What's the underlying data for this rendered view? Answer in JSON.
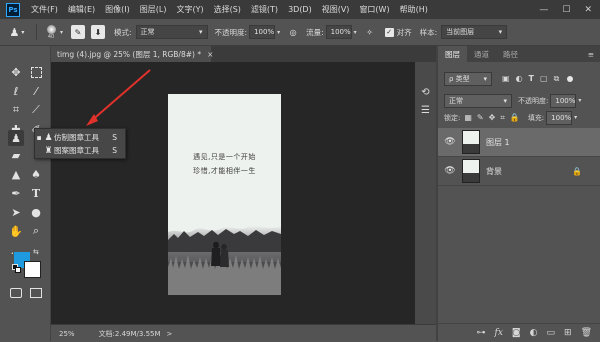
{
  "menubar": {
    "logo": "Ps",
    "items": [
      "文件(F)",
      "编辑(E)",
      "图像(I)",
      "图层(L)",
      "文字(Y)",
      "选择(S)",
      "滤镜(T)",
      "3D(D)",
      "视图(V)",
      "窗口(W)",
      "帮助(H)"
    ],
    "window_controls": [
      "—",
      "☐",
      "✕"
    ]
  },
  "options": {
    "brush_size": "40",
    "mode_label": "模式:",
    "mode_value": "正常",
    "opacity_label": "不透明度:",
    "opacity_value": "100%",
    "flow_label": "流量:",
    "flow_value": "100%",
    "aligned_label": "对齐",
    "sample_label": "样本:",
    "sample_value": "当前图层"
  },
  "document": {
    "tab_title": "timg (4).jpg @ 25% (图层 1, RGB/8#) *",
    "tab_close": "×",
    "text_line1": "遇见,只是一个开始",
    "text_line2": "珍惜,才能相伴一生"
  },
  "status": {
    "zoom": "25%",
    "doc_size": "文档:2.49M/3.55M",
    "arrow": ">"
  },
  "flyout": {
    "items": [
      {
        "label": "仿制图章工具",
        "shortcut": "S",
        "selected": true
      },
      {
        "label": "图案图章工具",
        "shortcut": "S",
        "selected": false
      }
    ]
  },
  "layers_panel": {
    "tabs": [
      "图层",
      "通道",
      "路径"
    ],
    "filter_label": "ρ 类型",
    "blend_mode": "正常",
    "opacity_label": "不透明度:",
    "opacity_value": "100%",
    "lock_label": "锁定:",
    "fill_label": "填充:",
    "fill_value": "100%",
    "layers": [
      {
        "name": "图层 1",
        "visible": true,
        "selected": true
      },
      {
        "name": "背景",
        "visible": true,
        "selected": false,
        "locked": true
      }
    ]
  },
  "colors": {
    "foreground": "#1e9ae0",
    "background": "#ffffff",
    "arrow": "#e0322b"
  }
}
